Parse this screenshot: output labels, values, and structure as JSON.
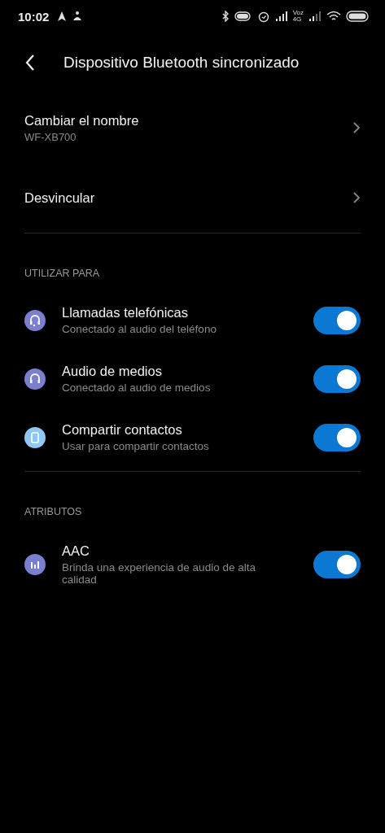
{
  "status_bar": {
    "time": "10:02",
    "network_label": [
      "Voz",
      "4G"
    ]
  },
  "header": {
    "title": "Dispositivo Bluetooth sincronizado"
  },
  "links": [
    {
      "title": "Cambiar el nombre",
      "subtitle": "WF-XB700"
    },
    {
      "title": "Desvincular"
    }
  ],
  "sections": [
    {
      "heading": "UTILIZAR PARA",
      "items": [
        {
          "title": "Llamadas telefónicas",
          "subtitle": "Conectado al audio del teléfono",
          "color": "#7b7fd0",
          "on": true
        },
        {
          "title": "Audio de medios",
          "subtitle": "Conectado al audio de medios",
          "color": "#7b7fd0",
          "on": true
        },
        {
          "title": "Compartir contactos",
          "subtitle": "Usar para compartir contactos",
          "color": "#8fc8f5",
          "on": true
        }
      ]
    },
    {
      "heading": "ATRIBUTOS",
      "items": [
        {
          "title": "AAC",
          "subtitle": "Brinda una experiencia de audio de alta calidad",
          "color": "#7b7fd0",
          "on": true
        }
      ]
    }
  ]
}
